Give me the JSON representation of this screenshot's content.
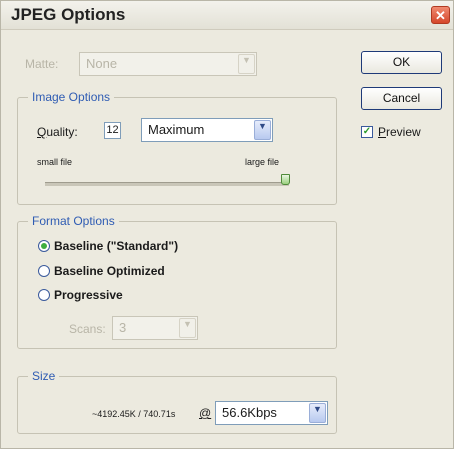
{
  "window": {
    "title": "JPEG Options",
    "close_glyph": "✕"
  },
  "matte": {
    "label": "Matte:",
    "value": "None"
  },
  "image_options": {
    "legend": "Image Options",
    "quality_label_u": "Q",
    "quality_label_rest": "uality:",
    "quality_value": "12",
    "quality_preset": "Maximum",
    "small_file": "small file",
    "large_file": "large file",
    "slider_fraction": 1.0
  },
  "format_options": {
    "legend": "Format Options",
    "options": [
      {
        "label": "Baseline (\"Standard\")",
        "selected": true
      },
      {
        "label": "Baseline Optimized",
        "selected": false
      },
      {
        "label": "Progressive",
        "selected": false
      }
    ],
    "scans_label": "Scans:",
    "scans_value": "3"
  },
  "size": {
    "legend": "Size",
    "readout": "~4192.45K / 740.71s",
    "at": "@",
    "speed": "56.6Kbps"
  },
  "buttons": {
    "ok": "OK",
    "cancel": "Cancel"
  },
  "preview": {
    "label_u": "P",
    "label_rest": "review",
    "checked": true,
    "check_glyph": "✓"
  },
  "icons": {
    "dropdown": "chevron-down-icon",
    "close": "close-icon"
  },
  "colors": {
    "legend_blue": "#2f5cb3",
    "check_green": "#2a9a2a"
  }
}
